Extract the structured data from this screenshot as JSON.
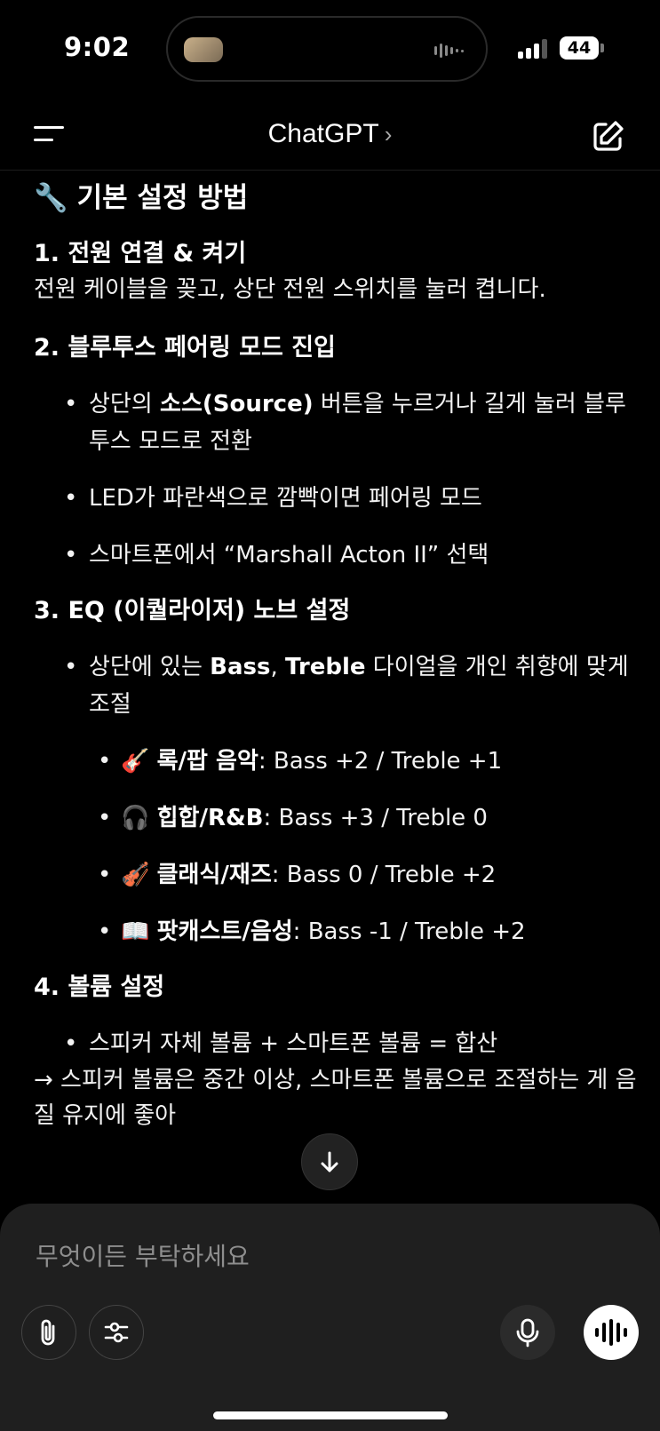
{
  "status": {
    "time": "9:02",
    "battery": "44"
  },
  "header": {
    "title": "ChatGPT",
    "chevron": "›"
  },
  "content": {
    "heading_emoji": "🔧",
    "heading": "기본 설정 방법",
    "step1": {
      "title": "1.  전원 연결 & 켜기",
      "body": "전원 케이블을 꽂고, 상단 전원 스위치를 눌러 켭니다."
    },
    "step2": {
      "title": "2.  블루투스 페어링 모드 진입",
      "b1_pre": "상단의 ",
      "b1_bold": "소스(Source)",
      "b1_post": " 버튼을 누르거나 길게 눌러 블루투스 모드로 전환",
      "b2": "LED가 파란색으로 깜빡이면 페어링 모드",
      "b3": "스마트폰에서 “Marshall Acton II” 선택"
    },
    "step3": {
      "title": "3.  EQ (이퀄라이저) 노브 설정",
      "b1_pre": "상단에 있는 ",
      "b1_bold1": "Bass",
      "b1_mid": ", ",
      "b1_bold2": "Treble",
      "b1_post": " 다이얼을 개인 취향에 맞게 조절",
      "presets": [
        {
          "emoji": "🎸",
          "label": "록/팝 음악",
          "value": ": Bass +2 / Treble +1"
        },
        {
          "emoji": "🎧",
          "label": "힙합/R&B",
          "value": ": Bass +3 / Treble 0"
        },
        {
          "emoji": "🎻",
          "label": "클래식/재즈",
          "value": ": Bass 0 / Treble +2"
        },
        {
          "emoji": "📖",
          "label": "팟캐스트/음성",
          "value": ": Bass -1 / Treble +2"
        }
      ]
    },
    "step4": {
      "title": "4.  볼륨 설정",
      "b1": "스피커 자체 볼륨 + 스마트폰 볼륨 = 합산",
      "tail": "→ 스피커 볼륨은 중간 이상, 스마트폰 볼륨으로 조절하는 게 음질 유지에 좋아"
    }
  },
  "composer": {
    "placeholder": "무엇이든 부탁하세요"
  }
}
